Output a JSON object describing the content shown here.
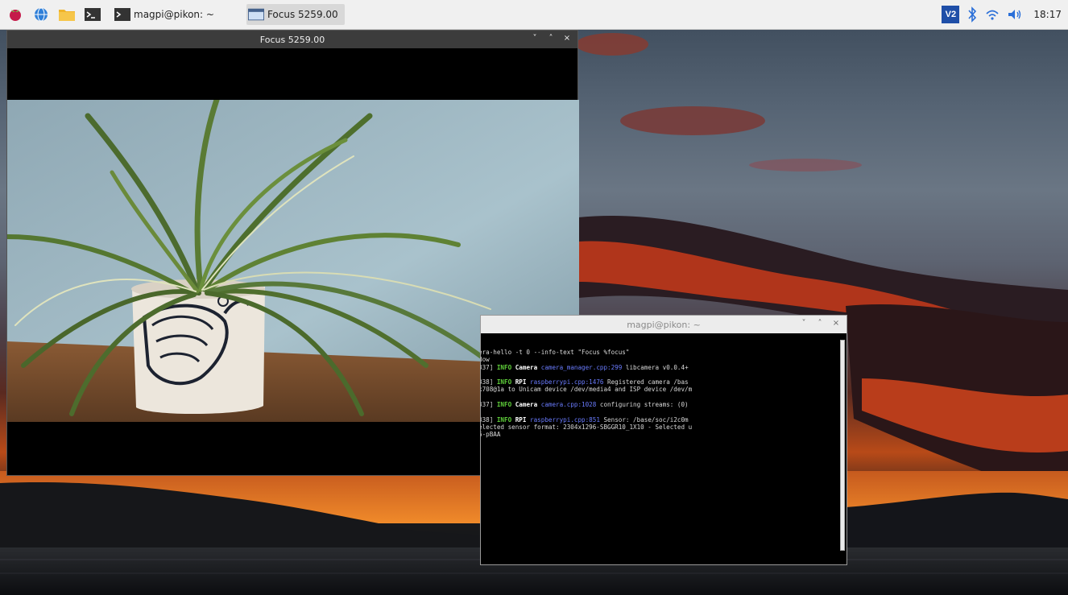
{
  "taskbar": {
    "launchers": [
      {
        "icon": "raspberry-menu-icon"
      },
      {
        "icon": "web-browser-icon"
      },
      {
        "icon": "file-manager-icon"
      },
      {
        "icon": "terminal-icon"
      }
    ],
    "tasks": [
      {
        "label": "magpi@pikon: ~",
        "icon": "terminal-icon",
        "active": false
      },
      {
        "label": "Focus 5259.00",
        "icon": "window-icon",
        "active": true
      }
    ],
    "tray": {
      "vnc_icon": "vnc-icon",
      "bluetooth_icon": "bluetooth-icon",
      "wifi_icon": "wifi-icon",
      "volume_icon": "volume-icon",
      "clock": "18:17"
    }
  },
  "focus_window": {
    "title": "Focus 5259.00",
    "buttons": [
      "˅",
      "˄",
      "×"
    ]
  },
  "terminal_window": {
    "title": "magpi@pikon: ~",
    "buttons": [
      "˅",
      "˄",
      "×"
    ],
    "lines": [
      {
        "prefix": "era-hello -t 0 --info-text \"Focus %focus\"",
        "tag": "",
        "comp": "",
        "loc": "",
        "rest": ""
      },
      {
        "prefix": "dow",
        "tag": "",
        "comp": "",
        "loc": "",
        "rest": ""
      },
      {
        "prefix": "337] ",
        "tag": "INFO",
        "comp": "Camera",
        "loc": "camera_manager.cpp:299",
        "rest": " libcamera v0.0.4+"
      },
      {
        "gap": true
      },
      {
        "prefix": "338] ",
        "tag": "INFO",
        "comp": "RPI",
        "loc": "raspberrypi.cpp:1476",
        "rest": " Registered camera /bas"
      },
      {
        "prefix": "x708@1a to Unicam device /dev/media4 and ISP device /dev/m",
        "tag": "",
        "comp": "",
        "loc": "",
        "rest": ""
      },
      {
        "gap": true
      },
      {
        "prefix": "337] ",
        "tag": "INFO",
        "comp": "Camera",
        "loc": "camera.cpp:1028",
        "rest": " configuring streams: (0)"
      },
      {
        "gap": true
      },
      {
        "prefix": "338] ",
        "tag": "INFO",
        "comp": "RPI",
        "loc": "raspberrypi.cpp:851",
        "rest": " Sensor: /base/soc/i2c0m"
      },
      {
        "prefix": "elected sensor format: 2304x1296-SBGGR10_1X10 - Selected u",
        "tag": "",
        "comp": "",
        "loc": "",
        "rest": ""
      },
      {
        "prefix": "6-pBAA",
        "tag": "",
        "comp": "",
        "loc": "",
        "rest": ""
      }
    ]
  },
  "colors": {
    "info_green": "#5fcf3a",
    "location_blue": "#6a7cff",
    "sunset_orange": "#e0561c"
  }
}
